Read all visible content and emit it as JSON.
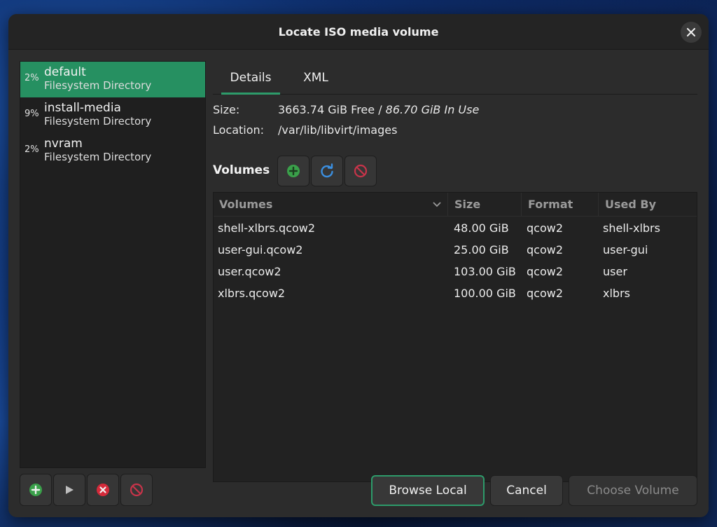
{
  "window": {
    "title": "Locate ISO media volume"
  },
  "pools": [
    {
      "percent": "2%",
      "name": "default",
      "type": "Filesystem Directory",
      "selected": true
    },
    {
      "percent": "9%",
      "name": "install-media",
      "type": "Filesystem Directory",
      "selected": false
    },
    {
      "percent": "2%",
      "name": "nvram",
      "type": "Filesystem Directory",
      "selected": false
    }
  ],
  "tabs": [
    "Details",
    "XML"
  ],
  "details": {
    "size_label": "Size:",
    "size_free": "3663.74 GiB Free / ",
    "size_inuse": "86.70 GiB In Use",
    "location_label": "Location:",
    "location_value": "/var/lib/libvirt/images",
    "volumes_label": "Volumes"
  },
  "table": {
    "headers": [
      "Volumes",
      "Size",
      "Format",
      "Used By"
    ],
    "rows": [
      {
        "name": "shell-xlbrs.qcow2",
        "size": "48.00 GiB",
        "format": "qcow2",
        "used_by": "shell-xlbrs"
      },
      {
        "name": "user-gui.qcow2",
        "size": "25.00 GiB",
        "format": "qcow2",
        "used_by": "user-gui"
      },
      {
        "name": "user.qcow2",
        "size": "103.00 GiB",
        "format": "qcow2",
        "used_by": "user"
      },
      {
        "name": "xlbrs.qcow2",
        "size": "100.00 GiB",
        "format": "qcow2",
        "used_by": "xlbrs"
      }
    ]
  },
  "buttons": {
    "browse_local": "Browse Local",
    "cancel": "Cancel",
    "choose_volume": "Choose Volume"
  },
  "colors": {
    "accent": "#269061",
    "add_green": "#3aa04a",
    "refresh_blue": "#3b8fe0",
    "stop_red": "#c8344a"
  }
}
